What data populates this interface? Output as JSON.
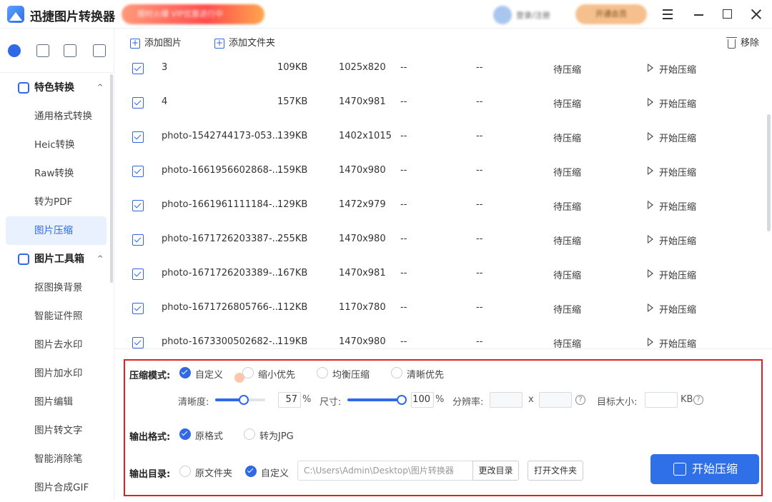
{
  "app": {
    "title": "迅捷图片转换器",
    "promo": "限时火爆 VIP优惠进行中",
    "user": "登录/注册",
    "vip": "开通会员"
  },
  "sidebar": {
    "categories": [
      {
        "label": "特色转换",
        "chevron": "^"
      },
      {
        "label": "图片工具箱",
        "chevron": "^"
      }
    ],
    "items1": [
      "通用格式转换",
      "Heic转换",
      "Raw转换",
      "转为PDF",
      "图片压缩"
    ],
    "items2": [
      "抠图换背景",
      "智能证件照",
      "图片去水印",
      "图片加水印",
      "图片编辑",
      "图片转文字",
      "智能消除笔",
      "图片合成GIF"
    ],
    "active": "图片压缩"
  },
  "toolbar": {
    "add_image": "添加图片",
    "add_folder": "添加文件夹",
    "remove": "移除"
  },
  "files": [
    {
      "name": "3",
      "size": "109KB",
      "dim": "1025x820",
      "a": "--",
      "b": "--",
      "status": "待压缩",
      "action": "开始压缩"
    },
    {
      "name": "4",
      "size": "157KB",
      "dim": "1470x981",
      "a": "--",
      "b": "--",
      "status": "待压缩",
      "action": "开始压缩"
    },
    {
      "name": "photo-1542744173-053...",
      "size": "139KB",
      "dim": "1402x1015",
      "a": "--",
      "b": "--",
      "status": "待压缩",
      "action": "开始压缩"
    },
    {
      "name": "photo-1661956602868-...",
      "size": "159KB",
      "dim": "1470x980",
      "a": "--",
      "b": "--",
      "status": "待压缩",
      "action": "开始压缩"
    },
    {
      "name": "photo-1661961111184-...",
      "size": "129KB",
      "dim": "1472x979",
      "a": "--",
      "b": "--",
      "status": "待压缩",
      "action": "开始压缩"
    },
    {
      "name": "photo-1671726203387-...",
      "size": "255KB",
      "dim": "1470x980",
      "a": "--",
      "b": "--",
      "status": "待压缩",
      "action": "开始压缩"
    },
    {
      "name": "photo-1671726203389-...",
      "size": "167KB",
      "dim": "1470x981",
      "a": "--",
      "b": "--",
      "status": "待压缩",
      "action": "开始压缩"
    },
    {
      "name": "photo-1671726805766-...",
      "size": "112KB",
      "dim": "1170x780",
      "a": "--",
      "b": "--",
      "status": "待压缩",
      "action": "开始压缩"
    },
    {
      "name": "photo-1673300502682-...",
      "size": "119KB",
      "dim": "1470x980",
      "a": "--",
      "b": "--",
      "status": "待压缩",
      "action": "开始压缩"
    }
  ],
  "settings": {
    "mode_label": "压缩模式:",
    "modes": [
      "自定义",
      "缩小优先",
      "均衡压缩",
      "清晰优先"
    ],
    "selected_mode": "自定义",
    "clarity_label": "清晰度:",
    "clarity_value": "57",
    "clarity_unit": "%",
    "clarity_fraction": 0.57,
    "size_label": "尺寸:",
    "size_value": "100",
    "size_unit": "%",
    "size_fraction": 1.0,
    "resolution_label": "分辨率:",
    "resolution_x": "x",
    "target_label": "目标大小:",
    "target_unit": "KB",
    "help": "?",
    "format_label": "输出格式:",
    "formats": [
      "原格式",
      "转为JPG"
    ],
    "selected_format": "原格式",
    "dir_label": "输出目录:",
    "dirs": [
      "原文件夹",
      "自定义"
    ],
    "selected_dir": "自定义",
    "path": "C:\\Users\\Admin\\Desktop\\图片转换器",
    "change_dir": "更改目录",
    "open_folder": "打开文件夹",
    "start_all": "开始压缩"
  },
  "colors": {
    "accent": "#2f6fe8",
    "highlight_border": "#e02020"
  }
}
